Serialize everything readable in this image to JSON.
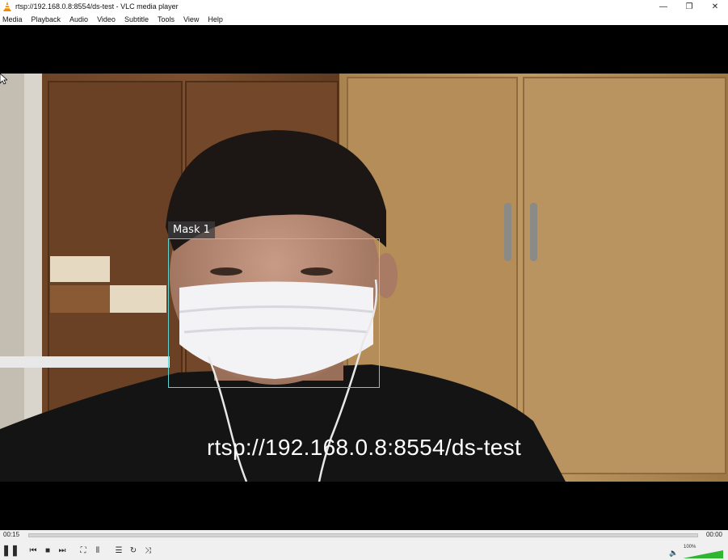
{
  "window": {
    "title": "rtsp://192.168.0.8:8554/ds-test - VLC media player",
    "controls": {
      "minimize": "—",
      "restore": "❐",
      "close": "✕"
    }
  },
  "menu": [
    "Media",
    "Playback",
    "Audio",
    "Video",
    "Subtitle",
    "Tools",
    "View",
    "Help"
  ],
  "video": {
    "detection_label": "Mask 1",
    "overlay_text": "rtsp://192.168.0.8:8554/ds-test"
  },
  "player": {
    "time_current": "00:15",
    "time_total": "00:00",
    "seek_progress": 0.0,
    "volume_label": "100%",
    "volume_level": 1.0,
    "buttons": {
      "play_pause": "❚❚",
      "previous": "⏮",
      "stop": "■",
      "next": "⏭",
      "fullscreen": "⛶",
      "extended": "⦀",
      "playlist": "☰",
      "loop": "↻",
      "shuffle": "⤨",
      "volume": "🔈"
    }
  },
  "colors": {
    "detection_box": "#5fd3cf",
    "volume_green": "#2fb52f"
  }
}
